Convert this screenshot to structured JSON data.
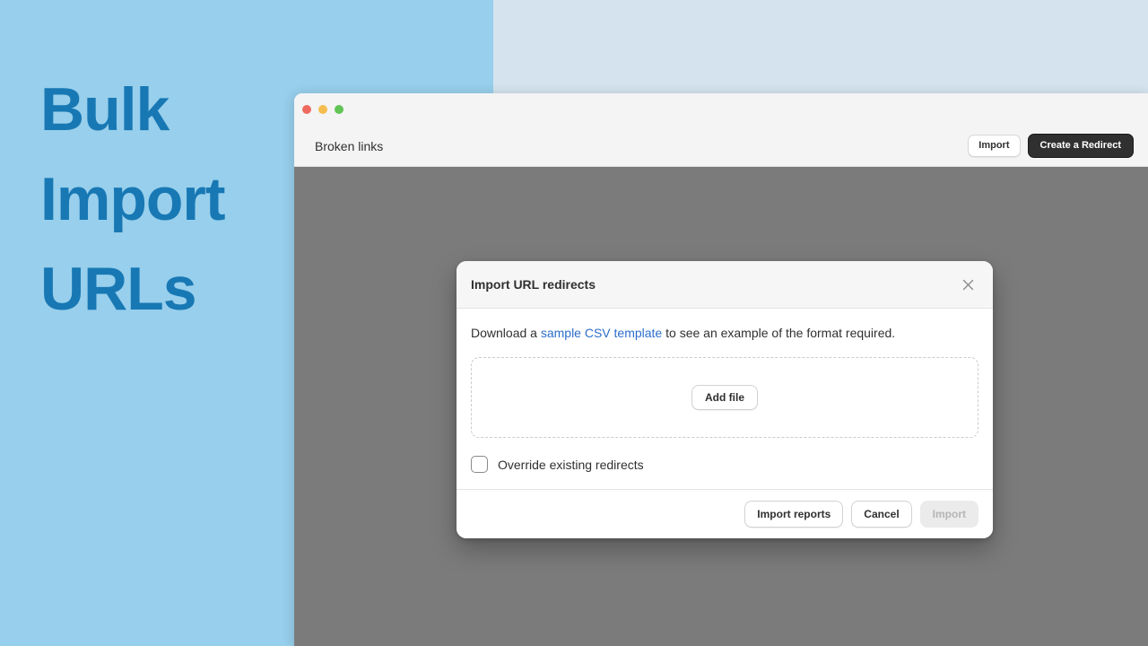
{
  "hero": {
    "heading": "Bulk\nImport\nURLs",
    "color": "#1878b4",
    "background_left": "#97cfec",
    "background_right": "#d4e3ed"
  },
  "window": {
    "traffic_lights": [
      "close-red",
      "minimize-yellow",
      "maximize-green"
    ],
    "toolbar": {
      "title": "Broken links",
      "import_button": "Import",
      "create_redirect_button": "Create a Redirect"
    }
  },
  "modal": {
    "title": "Import URL redirects",
    "close_icon": "close-icon",
    "description_prefix": "Download a ",
    "description_link": "sample CSV template",
    "description_suffix": " to see an example of the format required.",
    "link_color": "#2c6ecb",
    "dropzone": {
      "add_file_button": "Add file"
    },
    "checkbox": {
      "label": "Override existing redirects",
      "checked": false
    },
    "footer": {
      "import_reports_button": "Import reports",
      "cancel_button": "Cancel",
      "import_button": "Import",
      "import_disabled": true
    }
  }
}
